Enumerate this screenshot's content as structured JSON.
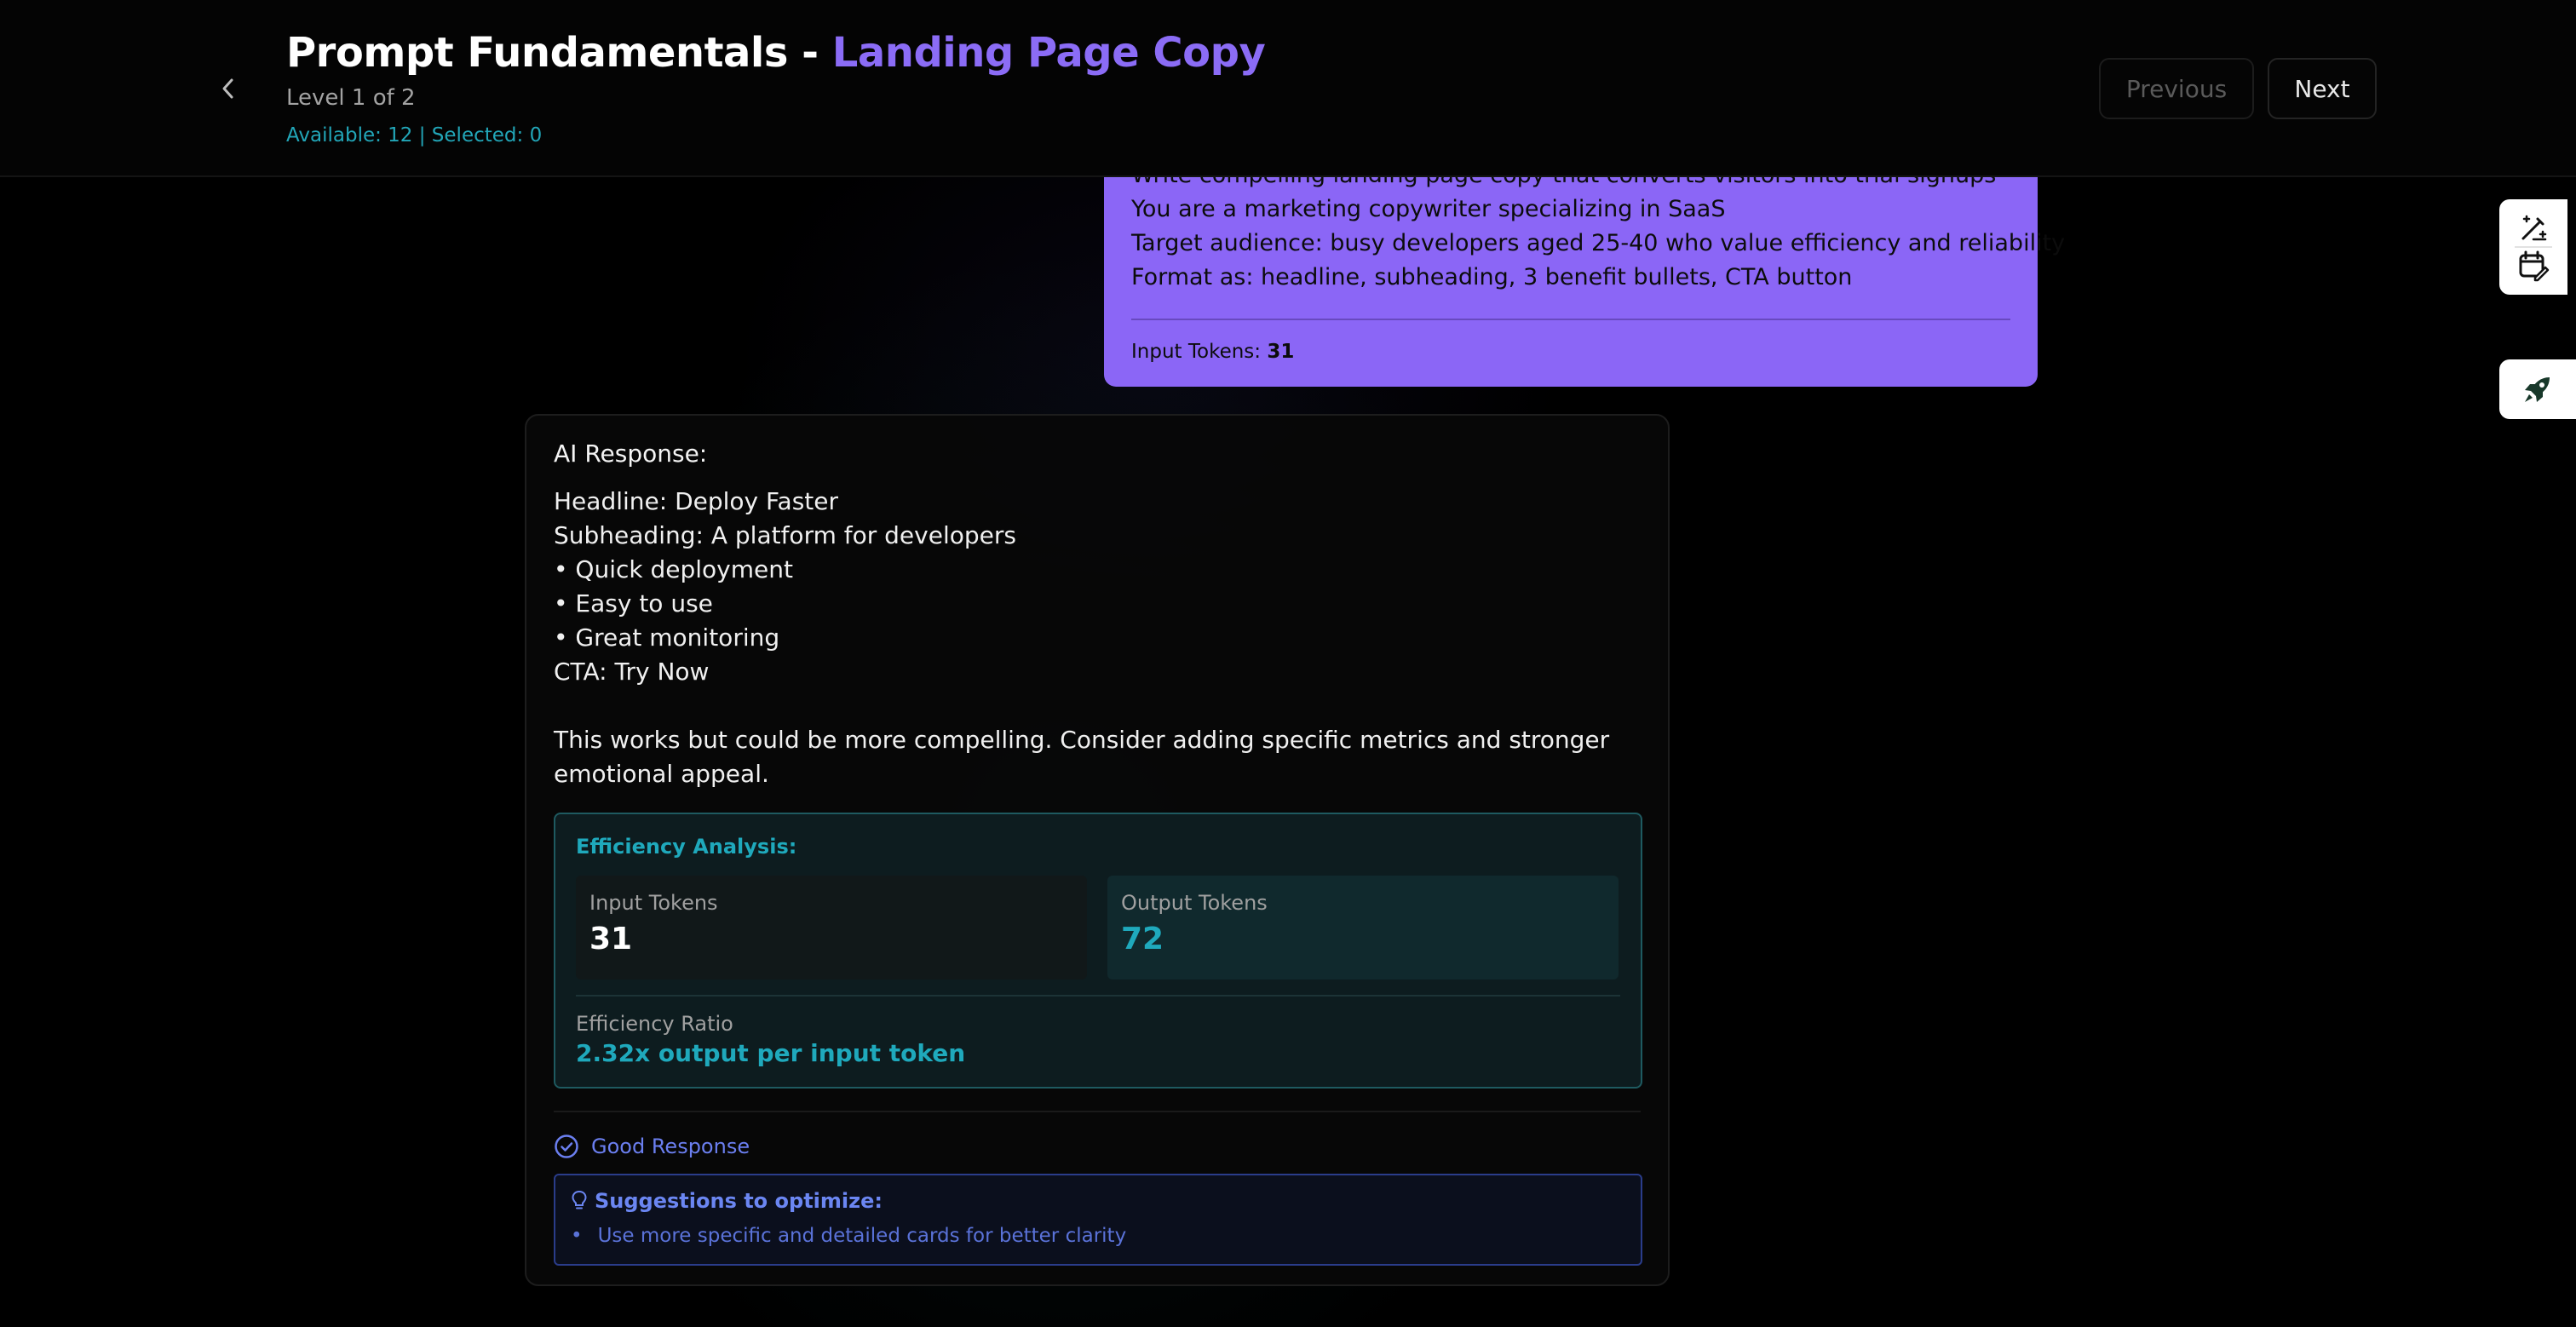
{
  "header": {
    "title_main": "Prompt Fundamentals - ",
    "title_accent": "Landing Page Copy",
    "level": "Level 1 of 2",
    "meta": "Available: 12 | Selected: 0",
    "previous_label": "Previous",
    "next_label": "Next",
    "back_icon": "chevron-left-icon"
  },
  "prompt": {
    "lines": [
      "Write compelling landing page copy that converts visitors into trial signups",
      "You are a marketing copywriter specializing in SaaS",
      "Target audience: busy developers aged 25-40 who value efficiency and reliability",
      "Format as: headline, subheading, 3 benefit bullets, CTA button"
    ],
    "tokens_label": "Input Tokens: ",
    "tokens_value": "31"
  },
  "response": {
    "heading": "AI Response:",
    "lines": [
      "Headline: Deploy Faster",
      "Subheading: A platform for developers",
      "• Quick deployment",
      "• Easy to use",
      "• Great monitoring",
      "CTA: Try Now"
    ],
    "note": "This works but could be more compelling. Consider adding specific metrics and stronger emotional appeal.",
    "efficiency": {
      "title": "Efficiency Analysis:",
      "input_label": "Input Tokens",
      "input_value": "31",
      "output_label": "Output Tokens",
      "output_value": "72",
      "ratio_label": "Efficiency Ratio",
      "ratio_value": "2.32x output per input token"
    },
    "status": "Good Response",
    "suggestions": {
      "title": "Suggestions to optimize:",
      "items": [
        "Use more specific and detailed cards for better clarity"
      ]
    }
  },
  "tools": [
    "edit-wand-icon",
    "calendar-edit-icon",
    "rocket-icon"
  ],
  "colors": {
    "accent_purple": "#8b66f6",
    "teal": "#1fa9bc",
    "blue": "#6b7ff0",
    "background": "#000000"
  }
}
